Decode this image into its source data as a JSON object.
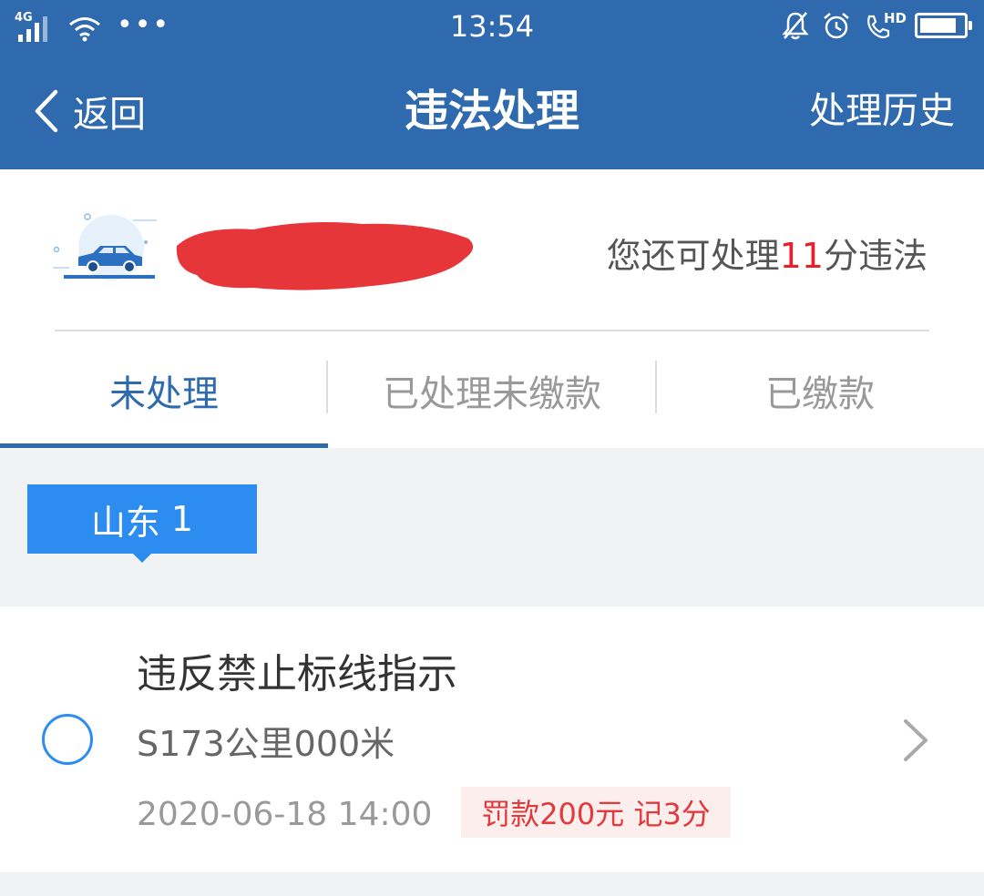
{
  "status_bar": {
    "network": "4G",
    "time": "13:54",
    "more_dots": "•••",
    "hd_label": "HD",
    "battery_level": 0.85
  },
  "nav": {
    "back_label": "返回",
    "title": "违法处理",
    "history_label": "处理历史"
  },
  "vehicle": {
    "points_prefix": "您还可处理",
    "points_value": "11",
    "points_suffix": "分违法"
  },
  "tabs": [
    {
      "label": "未处理",
      "active": true
    },
    {
      "label": "已处理未缴款",
      "active": false
    },
    {
      "label": "已缴款",
      "active": false
    }
  ],
  "plate": {
    "province": "山东",
    "suffix": "1"
  },
  "violations": [
    {
      "title": "违反禁止标线指示",
      "location": "S173公里000米",
      "time": "2020-06-18 14:00",
      "penalty": "罚款200元 记3分"
    }
  ],
  "colors": {
    "header_blue": "#2e6aad",
    "accent_blue": "#2d8cf0",
    "highlight_red": "#e4222b",
    "fine_bg": "#fdeeee"
  }
}
